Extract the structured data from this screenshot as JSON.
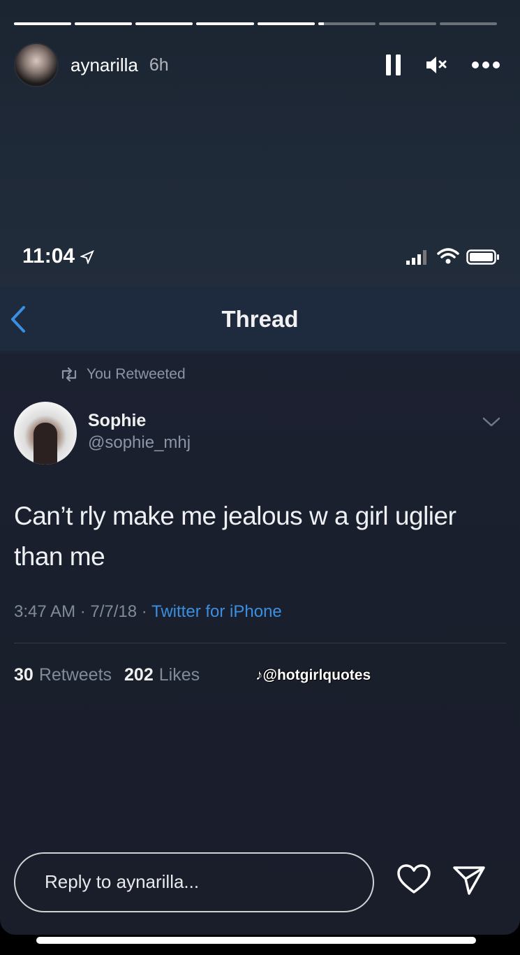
{
  "story": {
    "username": "aynarilla",
    "time_ago": "6h",
    "progress_segments": [
      1,
      1,
      1,
      1,
      1,
      0.1,
      0,
      0
    ]
  },
  "controls": {
    "pause_icon": "pause-icon",
    "mute_icon": "speaker-muted-icon",
    "more_icon": "more-dots-icon"
  },
  "screenshot": {
    "status_time": "11:04",
    "nav_title": "Thread",
    "retweet_label": "You Retweeted",
    "tweet": {
      "name": "Sophie",
      "handle": "@sophie_mhj",
      "text": "Can’t rly make me jealous w a girl uglier than me",
      "meta_time": "3:47 AM · 7/7/18 · ",
      "meta_source": "Twitter for iPhone",
      "retweets_count": "30",
      "retweets_label": "Retweets",
      "likes_count": "202",
      "likes_label": "Likes"
    },
    "watermark": "@hotgirlquotes"
  },
  "reply": {
    "placeholder": "Reply to aynarilla..."
  },
  "colors": {
    "link_blue": "#3b8fe0",
    "nav_bar": "#1e2a3e"
  }
}
